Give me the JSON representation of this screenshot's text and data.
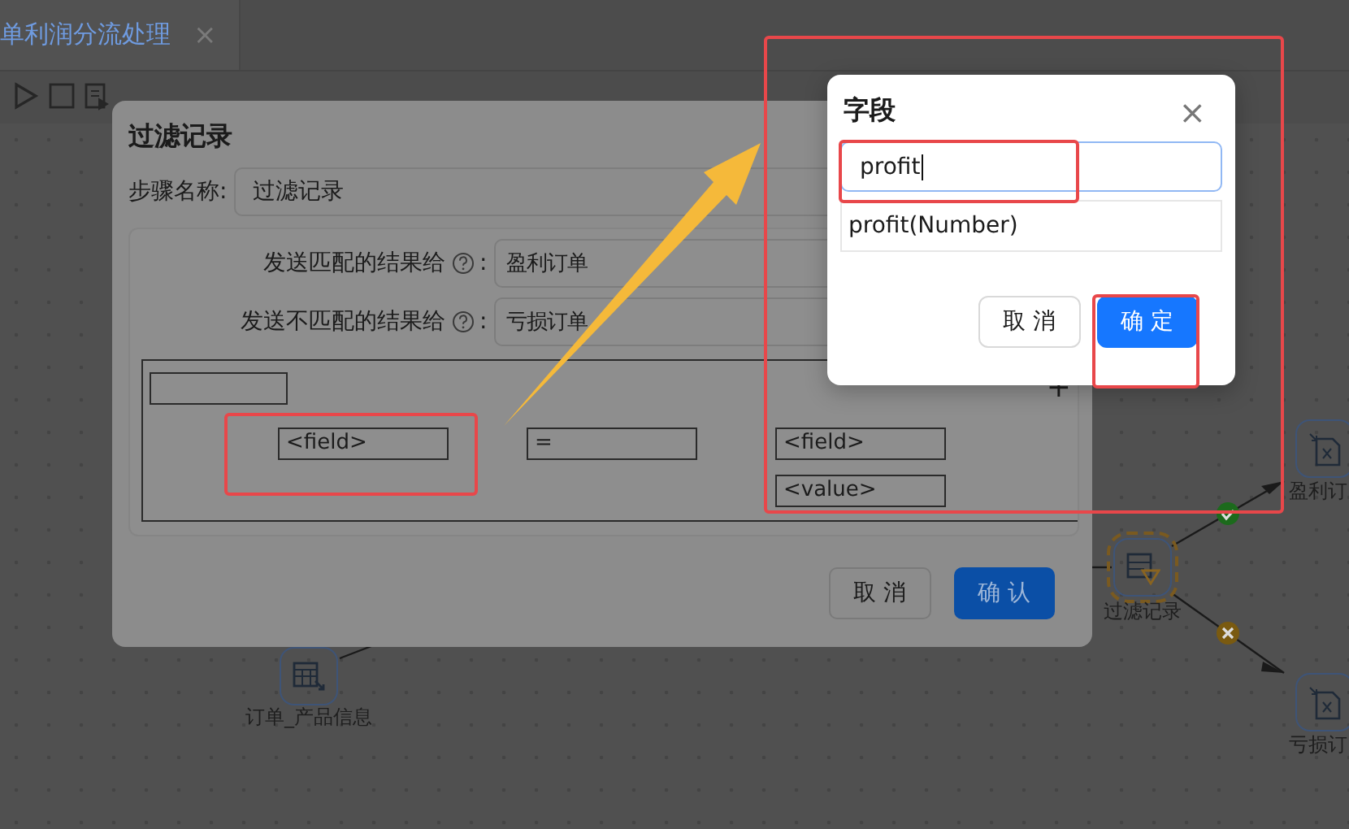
{
  "tab": {
    "title": "单利润分流处理",
    "close": "×"
  },
  "canvas": {
    "nodes": [
      {
        "label": "订单_产品信息",
        "kind": "table",
        "selected": false
      },
      {
        "label": "过滤记录",
        "kind": "filter",
        "selected": true
      },
      {
        "label": "盈利订",
        "kind": "excel",
        "selected": false
      },
      {
        "label": "亏损订",
        "kind": "excel",
        "selected": false
      }
    ],
    "hops": [
      {
        "kind": "plain"
      },
      {
        "kind": "plain"
      },
      {
        "kind": "success"
      },
      {
        "kind": "failure"
      }
    ]
  },
  "filter_dialog": {
    "title": "过滤记录",
    "step_name_label": "步骤名称:",
    "step_name": "过滤记录",
    "targets": [
      {
        "label": "发送匹配的结果给",
        "colon": ":",
        "value": "盈利订单"
      },
      {
        "label": "发送不匹配的结果给",
        "colon": ":",
        "value": "亏损订单"
      }
    ],
    "condition": {
      "left_field": "<field>",
      "operator": "=",
      "right_field": "<field>",
      "right_value": "<value>",
      "add": "+"
    },
    "buttons": [
      {
        "label": "取 消",
        "kind": "default"
      },
      {
        "label": "确 认",
        "kind": "primary"
      }
    ]
  },
  "field_dialog": {
    "title": "字段",
    "close": "×",
    "search": {
      "value": "profit"
    },
    "options": [
      "profit(Number)"
    ],
    "buttons": [
      {
        "label": "取 消",
        "kind": "default"
      },
      {
        "label": "确 定",
        "kind": "primary"
      }
    ]
  }
}
